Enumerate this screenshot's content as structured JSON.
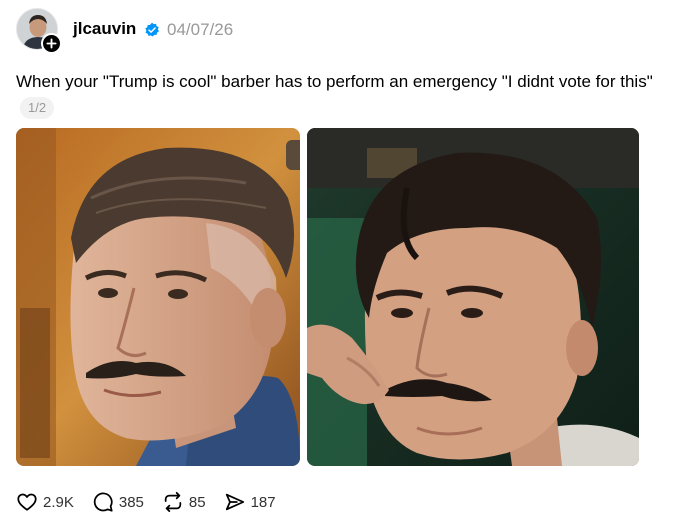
{
  "post": {
    "username": "jlcauvin",
    "date": "04/07/26",
    "verified": true,
    "caption": "When your \"Trump is cool\" barber has to perform an emergency \"I didnt vote for this\"",
    "page_counter": "1/2",
    "images": [
      {
        "icon": "photo-barber-haircut"
      },
      {
        "icon": "photo-mustache-twirl"
      }
    ]
  },
  "actions": {
    "likes": "2.9K",
    "replies": "385",
    "reposts": "85",
    "shares": "187"
  },
  "colors": {
    "text": "#000000",
    "muted": "#999999",
    "verified_blue": "#0095f6",
    "counter_bg": "#f2f2f2"
  }
}
